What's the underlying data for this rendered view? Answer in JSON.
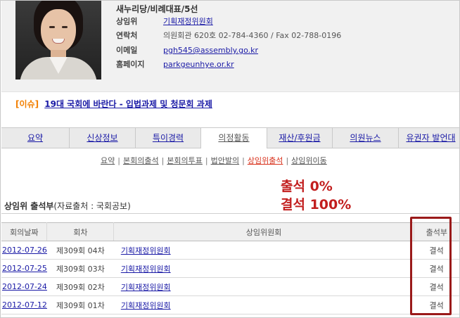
{
  "profile": {
    "party": "새누리당/비례대표/5선",
    "fields": [
      {
        "label": "상임위",
        "value": "기획재정위원회",
        "link": true
      },
      {
        "label": "연락처",
        "value": "의원회관 620호 02-784-4360 / Fax 02-788-0196",
        "link": false
      },
      {
        "label": "이메일",
        "value": "pgh545@assembly.go.kr",
        "link": true
      },
      {
        "label": "홈페이지",
        "value": "parkgeunhye.or.kr",
        "link": true
      }
    ]
  },
  "issue": {
    "tag": "[이슈]",
    "text": "19대 국회에 바란다 - 입법과제 및 청문회 과제"
  },
  "tabs": [
    {
      "label": "요약",
      "active": false
    },
    {
      "label": "신상정보",
      "active": false
    },
    {
      "label": "특이경력",
      "active": false
    },
    {
      "label": "의정활동",
      "active": true
    },
    {
      "label": "재산/후원금",
      "active": false
    },
    {
      "label": "의원뉴스",
      "active": false
    },
    {
      "label": "유권자 발언대",
      "active": false
    }
  ],
  "subnav": [
    {
      "label": "요약",
      "active": false
    },
    {
      "label": "본회의출석",
      "active": false
    },
    {
      "label": "본회의투표",
      "active": false
    },
    {
      "label": "법안발의",
      "active": false
    },
    {
      "label": "상임위출석",
      "active": true
    },
    {
      "label": "상임위이동",
      "active": false
    }
  ],
  "annotation": {
    "line1": "출석 0%",
    "line2": "결석 100%"
  },
  "section": {
    "title": "상임위 출석부",
    "source": "(자료출처 : 국회공보)"
  },
  "table": {
    "headers": [
      "회의날짜",
      "회차",
      "상임위원회",
      "출석부"
    ],
    "rows": [
      {
        "date": "2012-07-26",
        "session": "제309회 04차",
        "committee": "기획재정위원회",
        "attendance": "결석"
      },
      {
        "date": "2012-07-25",
        "session": "제309회 03차",
        "committee": "기획재정위원회",
        "attendance": "결석"
      },
      {
        "date": "2012-07-24",
        "session": "제309회 02차",
        "committee": "기획재정위원회",
        "attendance": "결석"
      },
      {
        "date": "2012-07-12",
        "session": "제309회 01차",
        "committee": "기획재정위원회",
        "attendance": "결석"
      }
    ]
  },
  "colors": {
    "link": "#1a1aa6",
    "issue_tag": "#f27f00",
    "active_subnav": "#d8321c",
    "annotation": "#c21e1e",
    "highlight_box": "#9a1a1a"
  }
}
